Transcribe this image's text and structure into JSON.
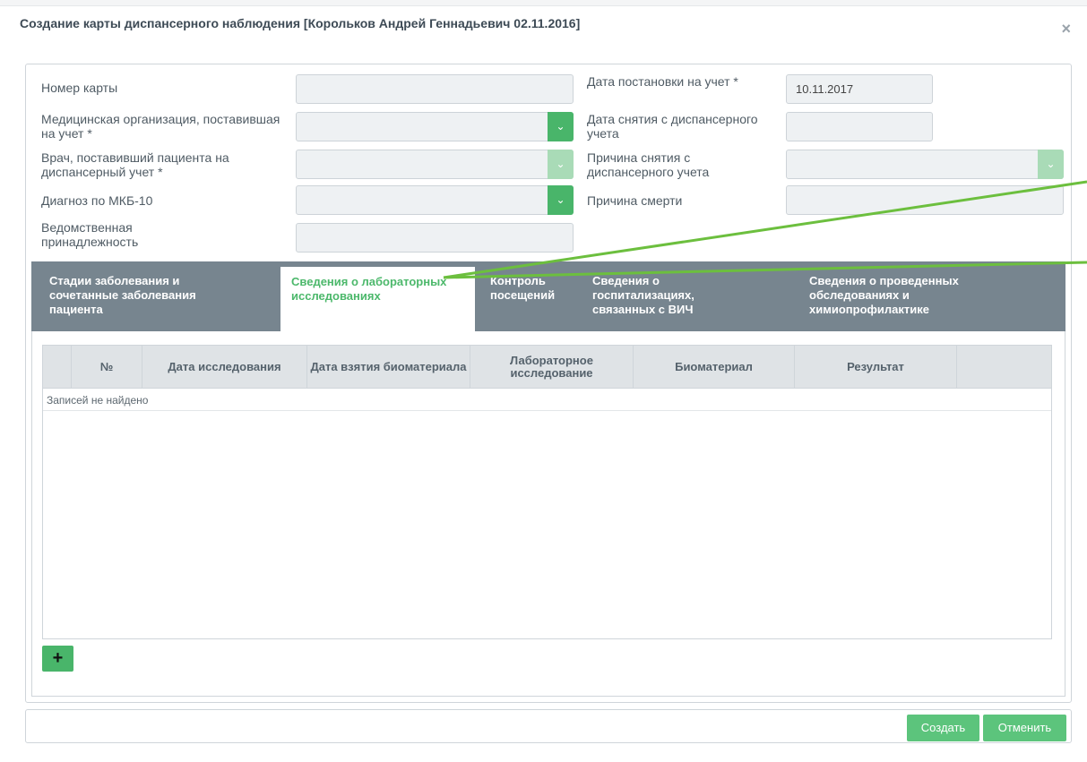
{
  "dialog": {
    "title": "Создание карты диспансерного наблюдения [Корольков Андрей Геннадьевич 02.11.2016]",
    "close_symbol": "×"
  },
  "form": {
    "card_number_label": "Номер карты",
    "card_number_value": "",
    "med_org_label": "Медицинская организация, поставившая на учет *",
    "doctor_label": "Врач, поставивший пациента на диспансерный учет *",
    "diagnosis_label": "Диагноз по МКБ-10",
    "department_label": "Ведомственная принадлежность",
    "reg_date_label": "Дата постановки на учет *",
    "reg_date_value": "10.11.2017",
    "dereg_date_label": "Дата снятия с диспансерного учета",
    "dereg_reason_label": "Причина снятия с диспансерного учета",
    "death_reason_label": "Причина смерти"
  },
  "tabs": [
    {
      "label": "Стадии заболевания и сочетанные заболевания пациента"
    },
    {
      "label": "Сведения о лабораторных исследованиях"
    },
    {
      "label": "Контроль посещений"
    },
    {
      "label": "Сведения о госпитализациях, связанных с ВИЧ"
    },
    {
      "label": "Сведения о проведенных обследованиях и химиопрофилактике"
    }
  ],
  "active_tab": 1,
  "grid": {
    "columns": [
      "№",
      "Дата исследования",
      "Дата взятия биоматериала",
      "Лабораторное исследование",
      "Биоматериал",
      "Результат"
    ],
    "empty_text": "Записей не найдено"
  },
  "buttons": {
    "add": "+",
    "create": "Создать",
    "cancel": "Отменить"
  },
  "colors": {
    "accent": "#49b56a",
    "tab_bar": "#77858f",
    "annotation_line": "#6cbf3e"
  },
  "icons": {
    "close": "close-icon",
    "dropdown": "chevron-down-icon",
    "add": "plus-icon"
  }
}
